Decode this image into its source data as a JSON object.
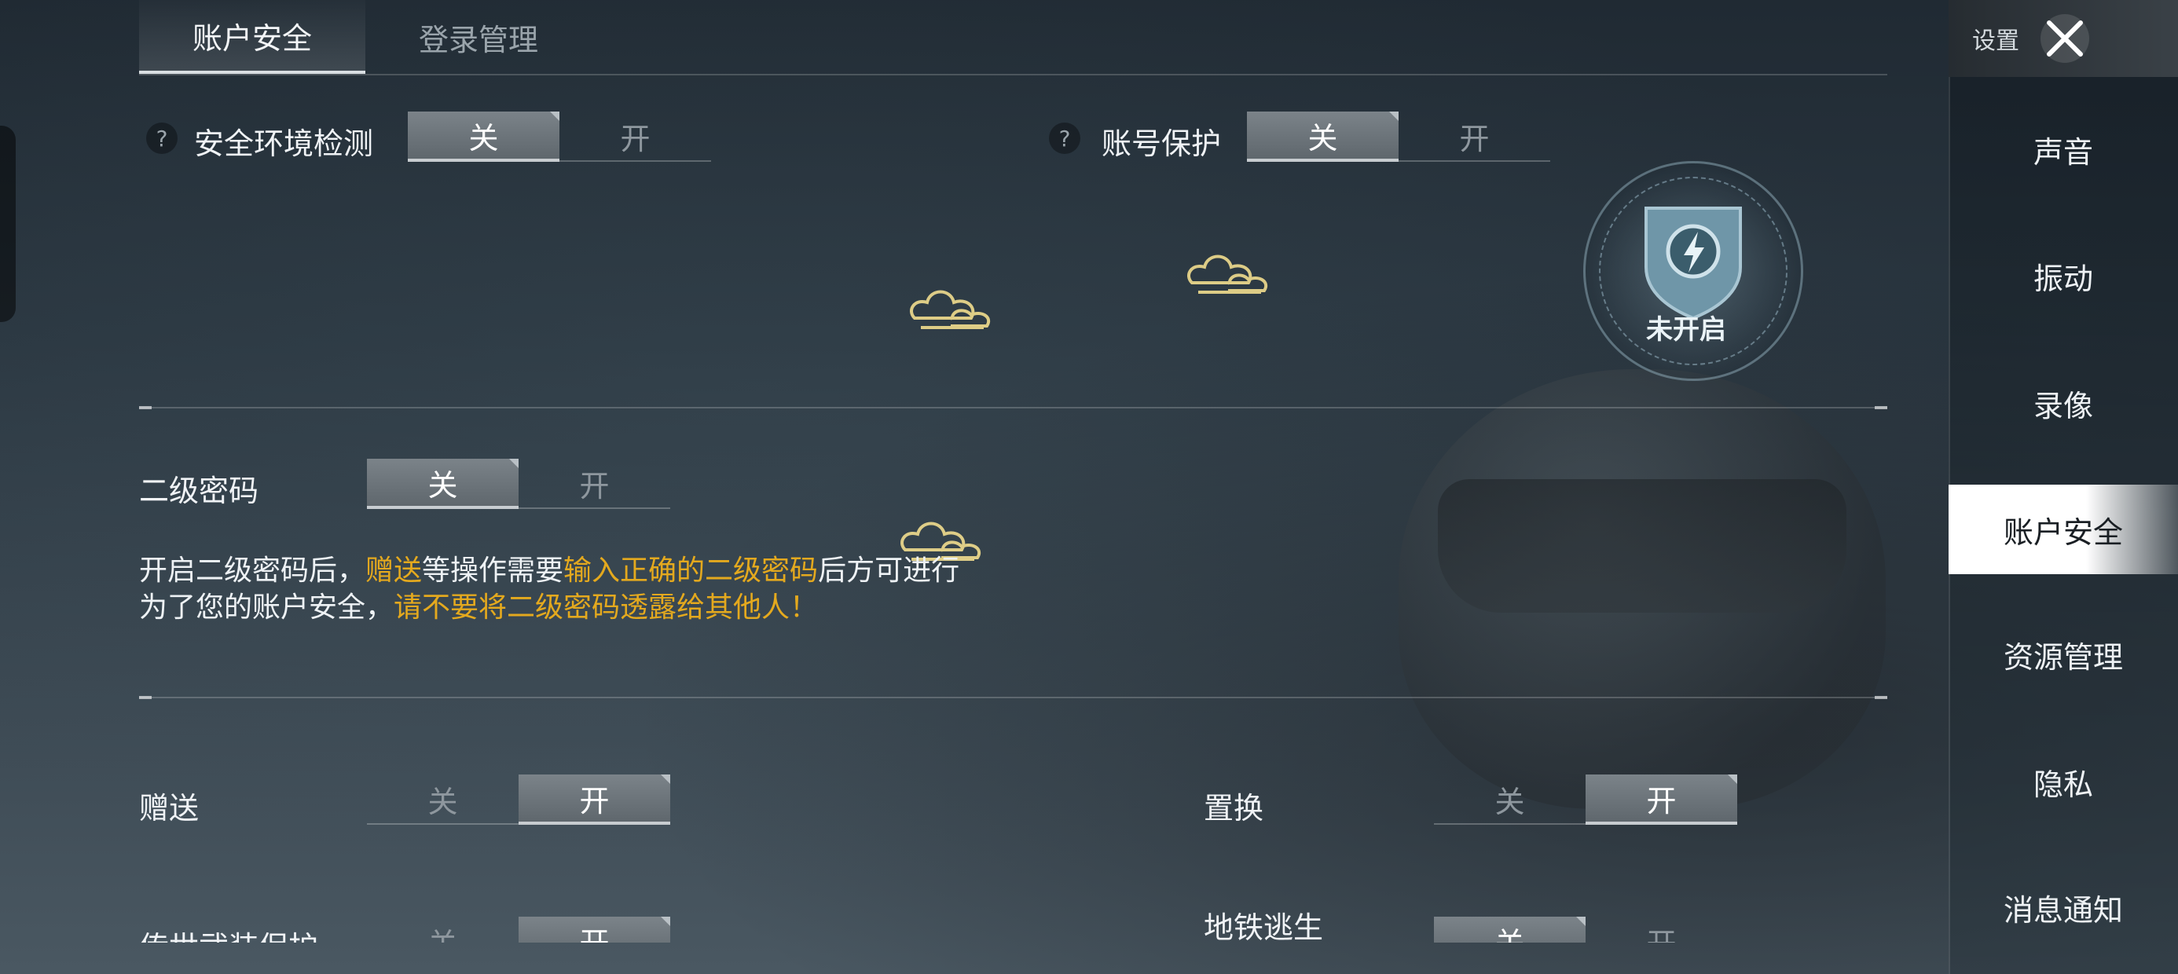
{
  "top_tabs": [
    {
      "label": "账户安全",
      "active": true
    },
    {
      "label": "登录管理",
      "active": false
    }
  ],
  "security_check": {
    "help": "?",
    "label": "安全环境检测",
    "off": "关",
    "on": "开",
    "state": "off"
  },
  "account_protect": {
    "help": "?",
    "label": "账号保护",
    "off": "关",
    "on": "开",
    "state": "off"
  },
  "badge": {
    "icon": "shield-bolt-icon",
    "text": "未开启"
  },
  "second_password": {
    "label": "二级密码",
    "off": "关",
    "on": "开",
    "state": "off",
    "desc_line1": {
      "p1": "开启二级密码后，",
      "h1": "赠送",
      "p2": "等操作需要",
      "h2": "输入正确的二级密码",
      "p3": "后方可进行"
    },
    "desc_line2": {
      "p1": "为了您的账户安全，",
      "h1": "请不要将二级密码透露给其他人！"
    }
  },
  "gift": {
    "label": "赠送",
    "off": "关",
    "on": "开",
    "state": "on"
  },
  "replace": {
    "label": "置换",
    "off": "关",
    "on": "开",
    "state": "on"
  },
  "legend_gear": {
    "label": "传世武装保护",
    "off": "关",
    "on": "开",
    "state": "on"
  },
  "metro_escape": {
    "label": "地铁逃生",
    "off": "关",
    "on": "开",
    "state": "off"
  },
  "sidebar": {
    "title": "设置",
    "items": [
      {
        "label": "声音",
        "active": false
      },
      {
        "label": "振动",
        "active": false
      },
      {
        "label": "录像",
        "active": false
      },
      {
        "label": "账户安全",
        "active": true
      },
      {
        "label": "资源管理",
        "active": false
      },
      {
        "label": "隐私",
        "active": false
      },
      {
        "label": "消息通知",
        "active": false
      }
    ]
  },
  "colors": {
    "highlight": "#e4a91e",
    "active_toggle": "#6f777d"
  }
}
